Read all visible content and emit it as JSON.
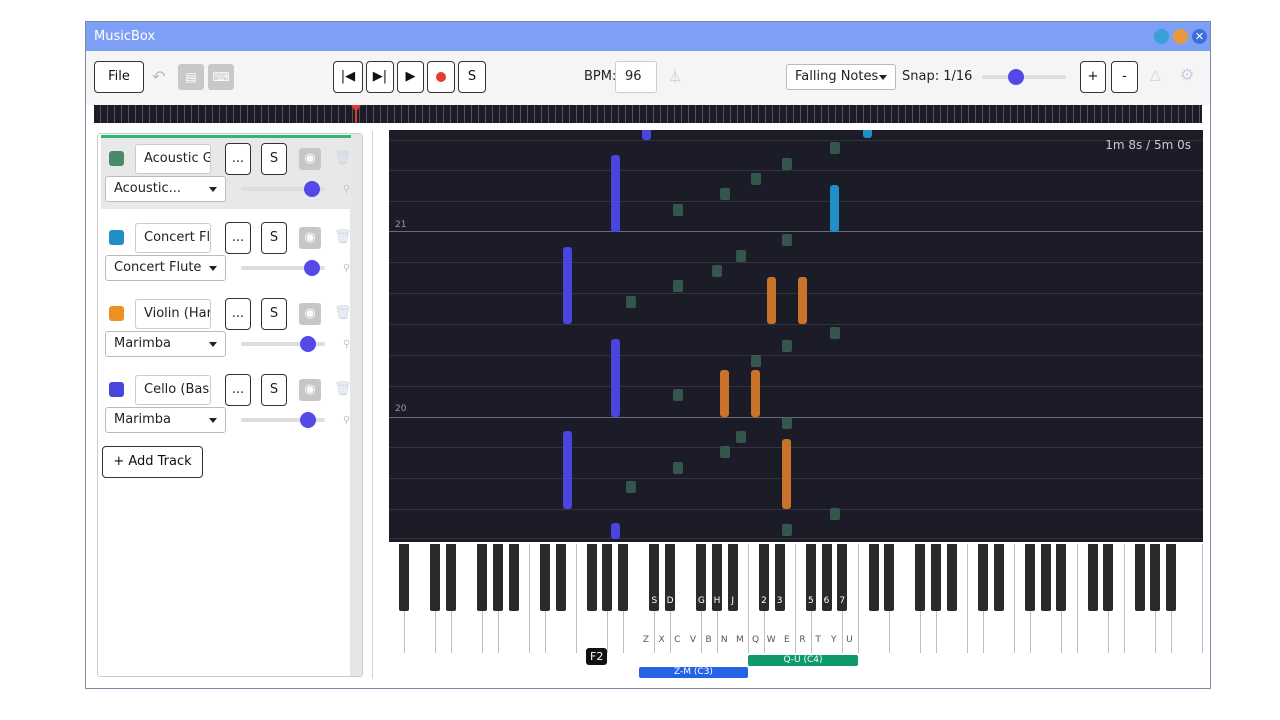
{
  "window": {
    "title": "MusicBox",
    "close_label": "✕"
  },
  "toolbar": {
    "file_label": "File",
    "undo_icon": "undo-icon",
    "transport": {
      "first": "|◀",
      "last": "▶|",
      "play": "▶",
      "solo": "S"
    },
    "bpm_label": "BPM:",
    "bpm_value": "96",
    "view_mode": "Falling Notes",
    "snap_label": "Snap: 1/16",
    "snap_slider": 0.4,
    "zoom_in": "+",
    "zoom_out": "-"
  },
  "tracks": [
    {
      "name": "Acoustic Gu",
      "instrument": "Acoustic...",
      "color": "#4a8a6a",
      "volume": 0.85,
      "selected": true
    },
    {
      "name": "Concert Flu",
      "instrument": "Concert Flute",
      "color": "#1f8ec9",
      "volume": 0.85,
      "selected": false
    },
    {
      "name": "Violin (Harr",
      "instrument": "Marimba",
      "color": "#ef8f22",
      "volume": 0.8,
      "selected": false
    },
    {
      "name": "Cello (Bass",
      "instrument": "Marimba",
      "color": "#4b45e0",
      "volume": 0.8,
      "selected": false
    }
  ],
  "track_buttons": {
    "more": "...",
    "solo": "S"
  },
  "add_track_label": "+ Add Track",
  "roll": {
    "timecode": "1m 8s / 5m 0s",
    "octave_labels": [
      "21",
      "20"
    ]
  },
  "keyboard": {
    "black_key_labels": [
      "S",
      "D",
      "G",
      "H",
      "J",
      "2",
      "3",
      "5",
      "6",
      "7"
    ],
    "white_key_labels": [
      "Z",
      "X",
      "C",
      "V",
      "B",
      "N",
      "M",
      "Q",
      "W",
      "E",
      "R",
      "T",
      "Y",
      "U"
    ],
    "range_low": "Z-M (C3)",
    "range_high": "Q-U (C4)",
    "hover_note": "F2"
  }
}
